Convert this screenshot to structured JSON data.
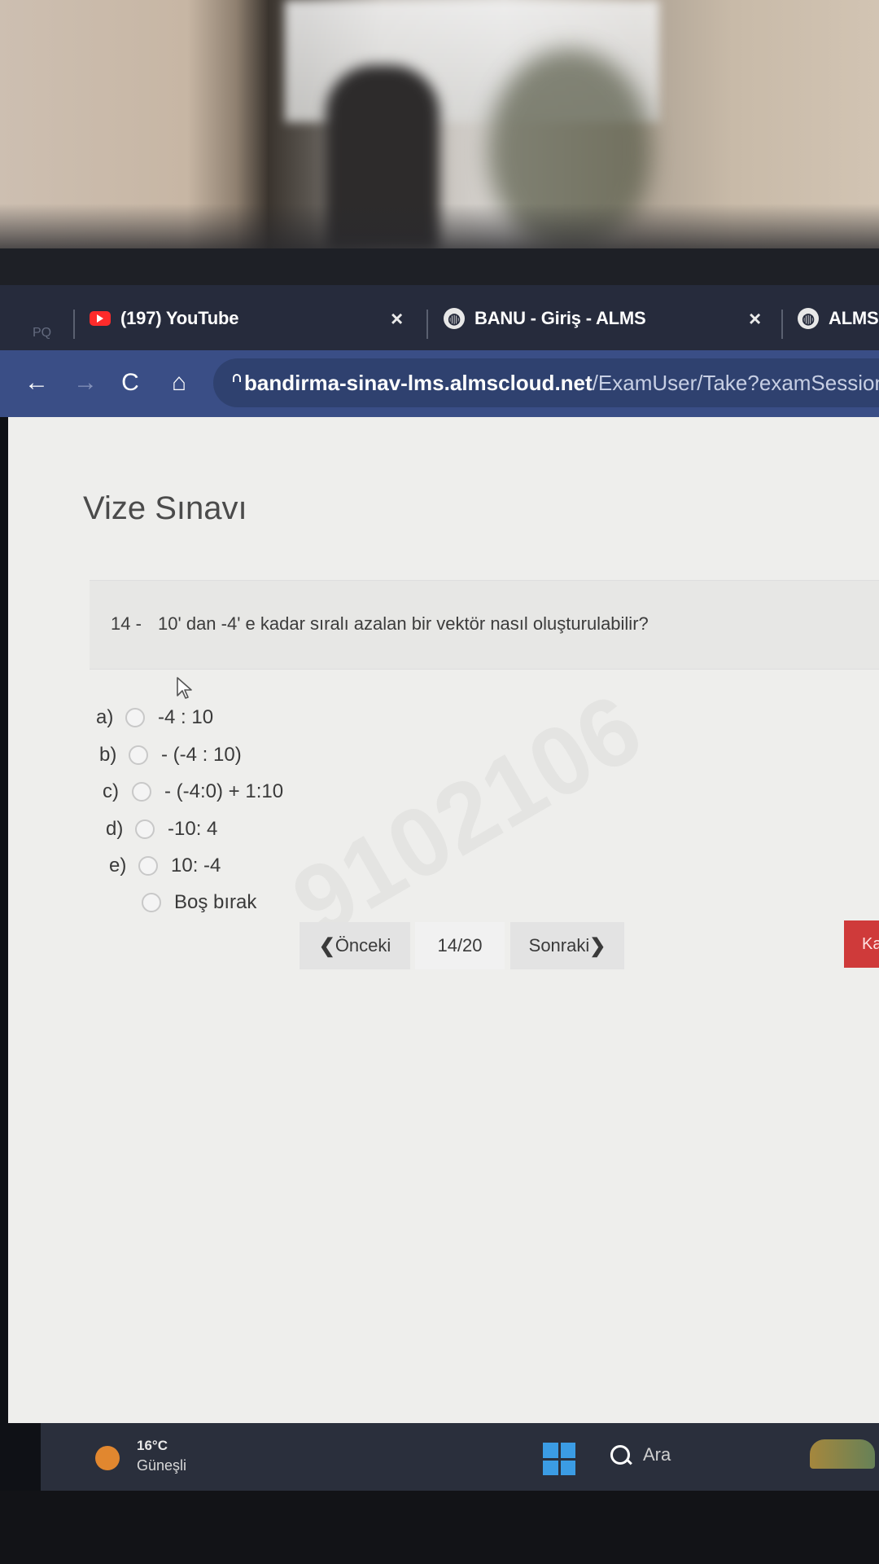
{
  "browser": {
    "pq_label": "PQ",
    "tabs": [
      {
        "title": "(197) YouTube",
        "close": "×"
      },
      {
        "title": "BANU - Giriş - ALMS",
        "close": "×"
      },
      {
        "title": "ALMS"
      }
    ],
    "nav": {
      "back": "←",
      "forward": "→",
      "reload": "C",
      "home": "⌂"
    },
    "url_host": "bandirma-sinav-lms.almscloud.net",
    "url_path": "/ExamUser/Take?examSessionIdRe"
  },
  "exam": {
    "title": "Vize Sınavı",
    "question_number": "14 -",
    "question_text": "10' dan -4' e kadar sıralı azalan bir vektör nasıl oluşturulabilir?",
    "options": [
      {
        "letter": "a)",
        "text": "-4 : 10"
      },
      {
        "letter": "b)",
        "text": "- (-4 : 10)"
      },
      {
        "letter": "c)",
        "text": "- (-4:0) + 1:10"
      },
      {
        "letter": "d)",
        "text": "-10: 4"
      },
      {
        "letter": "e)",
        "text": "10: -4"
      },
      {
        "letter": "",
        "text": "Boş bırak"
      }
    ],
    "watermark": "9102106",
    "pager": {
      "prev_arrow": "❮",
      "prev": "Önceki",
      "count": "14/20",
      "next": "Sonraki",
      "next_arrow": "❯"
    },
    "save_label": "Ka"
  },
  "taskbar": {
    "temperature": "16°C",
    "weather": "Güneşli",
    "search": "Ara"
  }
}
